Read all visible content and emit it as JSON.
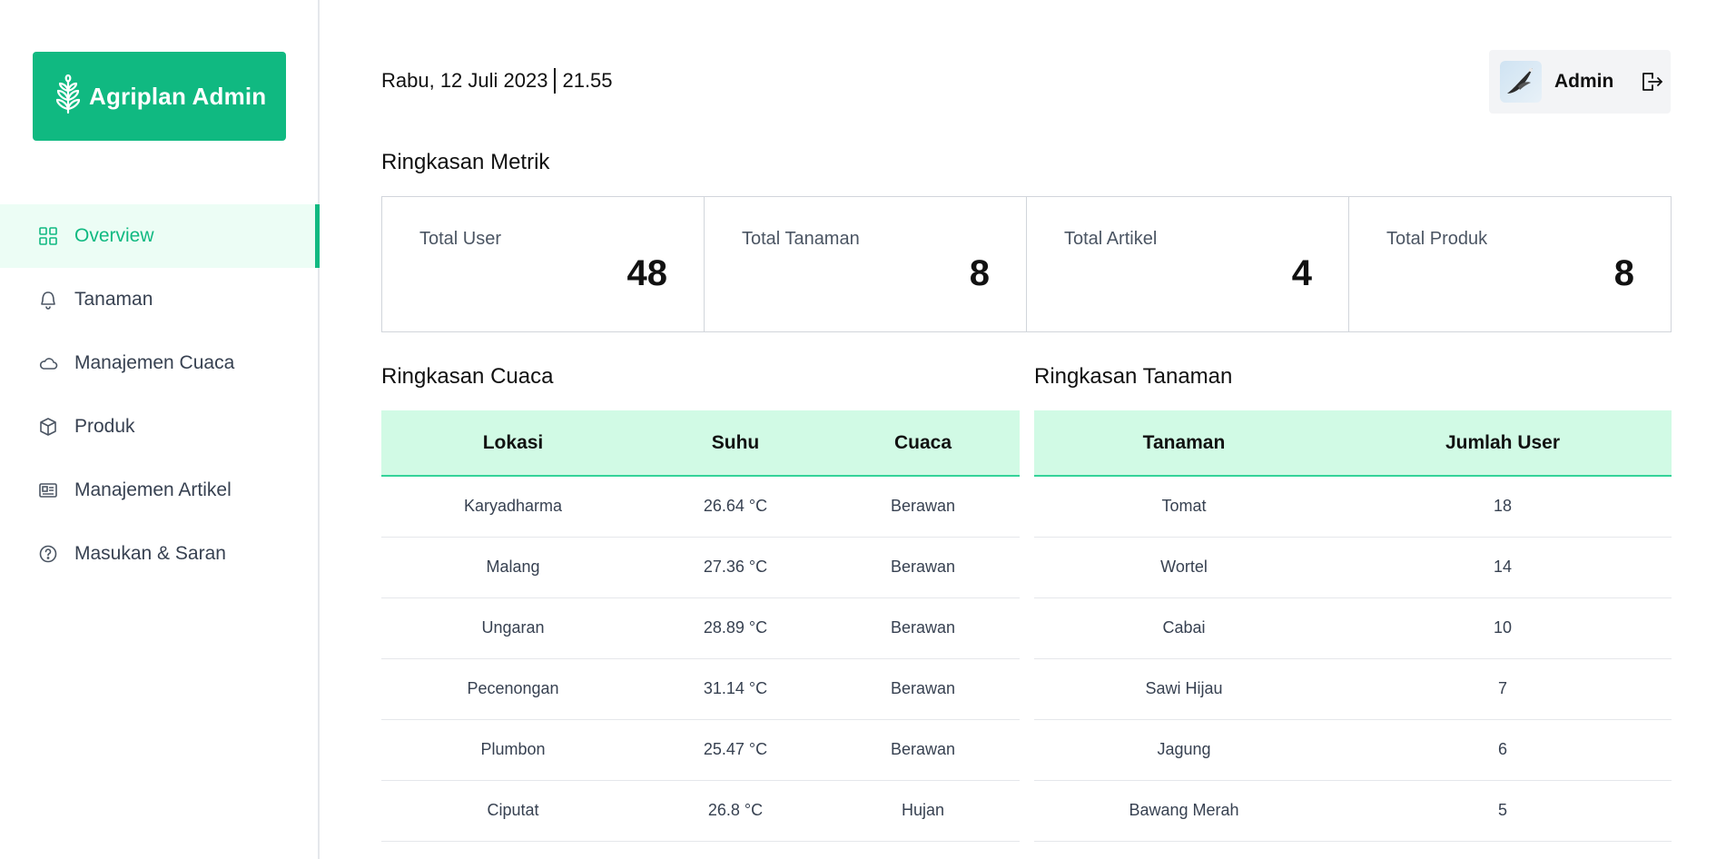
{
  "sidebar": {
    "logo_text": "Agriplan Admin",
    "items": [
      {
        "label": "Overview",
        "icon": "grid-icon",
        "active": true
      },
      {
        "label": "Tanaman",
        "icon": "plant-icon",
        "active": false
      },
      {
        "label": "Manajemen Cuaca",
        "icon": "cloud-icon",
        "active": false
      },
      {
        "label": "Produk",
        "icon": "box-icon",
        "active": false
      },
      {
        "label": "Manajemen Artikel",
        "icon": "article-icon",
        "active": false
      },
      {
        "label": "Masukan & Saran",
        "icon": "help-icon",
        "active": false
      }
    ]
  },
  "header": {
    "date": "Rabu, 12 Juli 2023",
    "time": "21.55",
    "user_name": "Admin"
  },
  "metrics": {
    "title": "Ringkasan Metrik",
    "cards": [
      {
        "label": "Total User",
        "value": "48"
      },
      {
        "label": "Total Tanaman",
        "value": "8"
      },
      {
        "label": "Total Artikel",
        "value": "4"
      },
      {
        "label": "Total Produk",
        "value": "8"
      }
    ]
  },
  "weather": {
    "title": "Ringkasan Cuaca",
    "columns": [
      "Lokasi",
      "Suhu",
      "Cuaca"
    ],
    "rows": [
      [
        "Karyadharma",
        "26.64 °C",
        "Berawan"
      ],
      [
        "Malang",
        "27.36 °C",
        "Berawan"
      ],
      [
        "Ungaran",
        "28.89 °C",
        "Berawan"
      ],
      [
        "Pecenongan",
        "31.14 °C",
        "Berawan"
      ],
      [
        "Plumbon",
        "25.47 °C",
        "Berawan"
      ],
      [
        "Ciputat",
        "26.8 °C",
        "Hujan"
      ]
    ]
  },
  "plants": {
    "title": "Ringkasan Tanaman",
    "columns": [
      "Tanaman",
      "Jumlah User"
    ],
    "rows": [
      [
        "Tomat",
        "18"
      ],
      [
        "Wortel",
        "14"
      ],
      [
        "Cabai",
        "10"
      ],
      [
        "Sawi Hijau",
        "7"
      ],
      [
        "Jagung",
        "6"
      ],
      [
        "Bawang Merah",
        "5"
      ]
    ]
  },
  "colors": {
    "accent": "#10b981",
    "active_bg": "#ecfdf5",
    "table_header_bg": "#d1fae5"
  }
}
